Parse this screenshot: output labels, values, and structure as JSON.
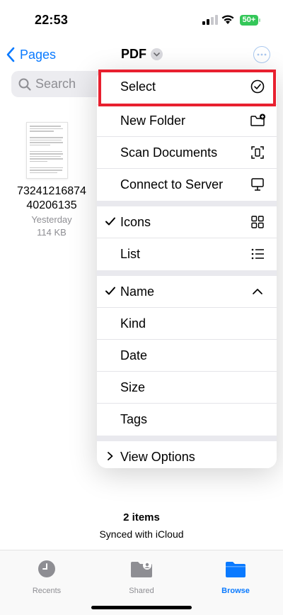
{
  "status_bar": {
    "time": "22:53",
    "battery": "50+"
  },
  "nav": {
    "back_label": "Pages",
    "title": "PDF"
  },
  "search": {
    "placeholder": "Search"
  },
  "file": {
    "name": "73241216874 40206135",
    "date": "Yesterday",
    "size": "114 KB"
  },
  "menu": {
    "items": [
      {
        "label": "Select",
        "icon": "checkmark-circle-icon"
      },
      {
        "label": "New Folder",
        "icon": "folder-plus-icon"
      },
      {
        "label": "Scan Documents",
        "icon": "document-scan-icon"
      },
      {
        "label": "Connect to Server",
        "icon": "server-display-icon"
      },
      {
        "label": "Icons",
        "icon": "grid-icon",
        "checked": true
      },
      {
        "label": "List",
        "icon": "list-icon"
      },
      {
        "label": "Name",
        "icon": "chevron-up-icon",
        "checked": true
      },
      {
        "label": "Kind"
      },
      {
        "label": "Date"
      },
      {
        "label": "Size"
      },
      {
        "label": "Tags"
      },
      {
        "label": "View Options",
        "icon": "chevron-right-icon"
      }
    ]
  },
  "footer": {
    "items_count": "2 items",
    "sync_status": "Synced with iCloud"
  },
  "tabs": [
    {
      "label": "Recents",
      "icon": "clock-icon",
      "active": false
    },
    {
      "label": "Shared",
      "icon": "shared-folder-icon",
      "active": false
    },
    {
      "label": "Browse",
      "icon": "folder-icon",
      "active": true
    }
  ],
  "colors": {
    "accent": "#0a7aff",
    "highlight": "#e8202f",
    "battery": "#34c759"
  }
}
